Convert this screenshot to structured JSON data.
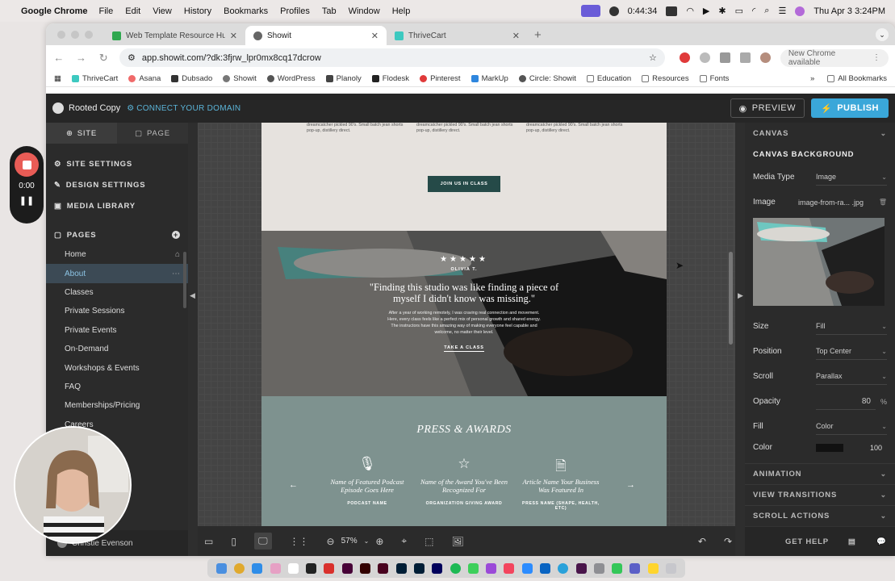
{
  "menubar": {
    "app_name": "Google Chrome",
    "items": [
      "File",
      "Edit",
      "View",
      "History",
      "Bookmarks",
      "Profiles",
      "Tab",
      "Window",
      "Help"
    ],
    "timer": "0:44:34",
    "datetime": "Thu Apr 3  3:24PM"
  },
  "chrome": {
    "tabs": [
      {
        "label": "Web Template Resource Hub",
        "favicon_color": "#2fa84f"
      },
      {
        "label": "Showit",
        "favicon_color": "#666666",
        "active": true
      },
      {
        "label": "ThriveCart",
        "favicon_color": "#3dc9c0"
      }
    ],
    "url": "app.showit.com/?dk:3fjrw_lpr0mx8cq17dcrow",
    "new_chrome": "New Chrome available",
    "bookmarks": [
      "ThriveCart",
      "Asana",
      "Dubsado",
      "Showit",
      "WordPress",
      "Planoly",
      "Flodesk",
      "Pinterest",
      "MarkUp",
      "Circle: Showit",
      "Education",
      "Resources",
      "Fonts"
    ],
    "all_bookmarks": "All Bookmarks"
  },
  "app": {
    "site_name": "Rooted Copy",
    "connect_domain": "CONNECT YOUR DOMAIN",
    "preview": "PREVIEW",
    "publish": "PUBLISH"
  },
  "left_panel": {
    "tab_site": "SITE",
    "tab_page": "PAGE",
    "site_settings": "SITE SETTINGS",
    "design_settings": "DESIGN SETTINGS",
    "media_library": "MEDIA LIBRARY",
    "pages_label": "PAGES",
    "pages": [
      "Home",
      "About",
      "Classes",
      "Private Sessions",
      "Private Events",
      "On-Demand",
      "Workshops & Events",
      "FAQ",
      "Memberships/Pricing",
      "Careers"
    ],
    "user_name": "Christie Evenson"
  },
  "canvas": {
    "col_text": "dreamcatcher pickled 90's. Small batch jean shorts pop-up, distillery direct.",
    "join_button": "JOIN US IN CLASS",
    "stars": "★★★★★",
    "author": "OLIVIA T.",
    "quote": "\"Finding this studio was like finding a piece of myself I didn't know was missing.\"",
    "body": "After a year of working remotely, I was craving real connection and movement. Here, every class feels like a perfect mix of personal growth and shared energy. The instructors have this amazing way of making everyone feel capable and welcome, no matter their level.",
    "cta": "TAKE A CLASS",
    "press_title": "PRESS & AWARDS",
    "press_items": [
      {
        "icon": "microphone-icon",
        "name": "Name of Featured Podcast Episode Goes Here",
        "sub": "PODCAST NAME"
      },
      {
        "icon": "star-icon",
        "name": "Name of the Award You've Been Recognized For",
        "sub": "ORGANIZATION GIVING AWARD"
      },
      {
        "icon": "document-icon",
        "name": "Article Name Your Business Was Featured In",
        "sub": "PRESS NAME (SHAPE, HEALTH, ETC)"
      }
    ]
  },
  "bottom_bar": {
    "zoom": "57%",
    "get_help": "GET HELP"
  },
  "right_panel": {
    "canvas": "CANVAS",
    "canvas_background": "CANVAS BACKGROUND",
    "media_type_label": "Media Type",
    "media_type_value": "Image",
    "image_label": "Image",
    "image_value": "image-from-ra... .jpg",
    "size_label": "Size",
    "size_value": "Fill",
    "position_label": "Position",
    "position_value": "Top Center",
    "scroll_label": "Scroll",
    "scroll_value": "Parallax",
    "opacity_label": "Opacity",
    "opacity_value": "80",
    "opacity_unit": "%",
    "fill_label": "Fill",
    "fill_value": "Color",
    "color_label": "Color",
    "color_value": "100",
    "animation": "ANIMATION",
    "view_transitions": "VIEW TRANSITIONS",
    "scroll_actions": "SCROLL ACTIONS"
  },
  "recording": {
    "time": "0:00"
  },
  "colors": {
    "accent_blue": "#3aa7d9",
    "record_red": "#e85c56",
    "button_green": "#254a48",
    "press_bg": "#7e928f"
  }
}
